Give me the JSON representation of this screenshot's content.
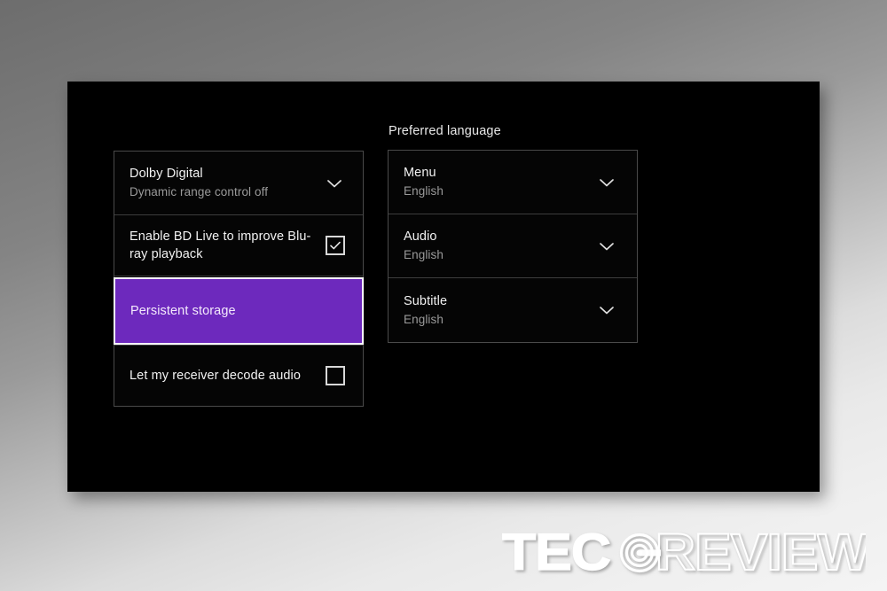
{
  "background": {
    "gradient_from": "#6d6d6d",
    "gradient_to": "#f4f4f4"
  },
  "console_panel": {
    "background_color": "#000000"
  },
  "colors": {
    "highlight_purple": "#6d29bd",
    "focus_border": "#ffffff",
    "primary_text": "#f2f2f2",
    "secondary_text": "#9a9a9a",
    "divider": "#3d3d3d"
  },
  "left_list": {
    "rows": [
      {
        "title": "Dolby Digital",
        "subtitle": "Dynamic range control off",
        "control": "chevron-down",
        "selected": false
      },
      {
        "title": "Enable BD Live to improve Blu-ray playback",
        "subtitle": "",
        "control": "checkbox",
        "checked": true,
        "selected": false
      },
      {
        "title": "Persistent storage",
        "subtitle": "",
        "control": "none",
        "selected": true
      },
      {
        "title": "Let my receiver decode audio",
        "subtitle": "",
        "control": "checkbox",
        "checked": false,
        "selected": false
      }
    ]
  },
  "right_column": {
    "section_label": "Preferred language",
    "rows": [
      {
        "title": "Menu",
        "subtitle": "English",
        "control": "chevron-down"
      },
      {
        "title": "Audio",
        "subtitle": "English",
        "control": "chevron-down"
      },
      {
        "title": "Subtitle",
        "subtitle": "English",
        "control": "chevron-down"
      }
    ]
  },
  "watermark": {
    "text_solid": "TEC",
    "text_outline": "REVIEWS",
    "icon": "target-spiral-icon"
  },
  "icons": {
    "chevron_down": "chevron-down-icon",
    "checkbox_checked": "checkbox-checked-icon",
    "checkbox_unchecked": "checkbox-unchecked-icon"
  }
}
